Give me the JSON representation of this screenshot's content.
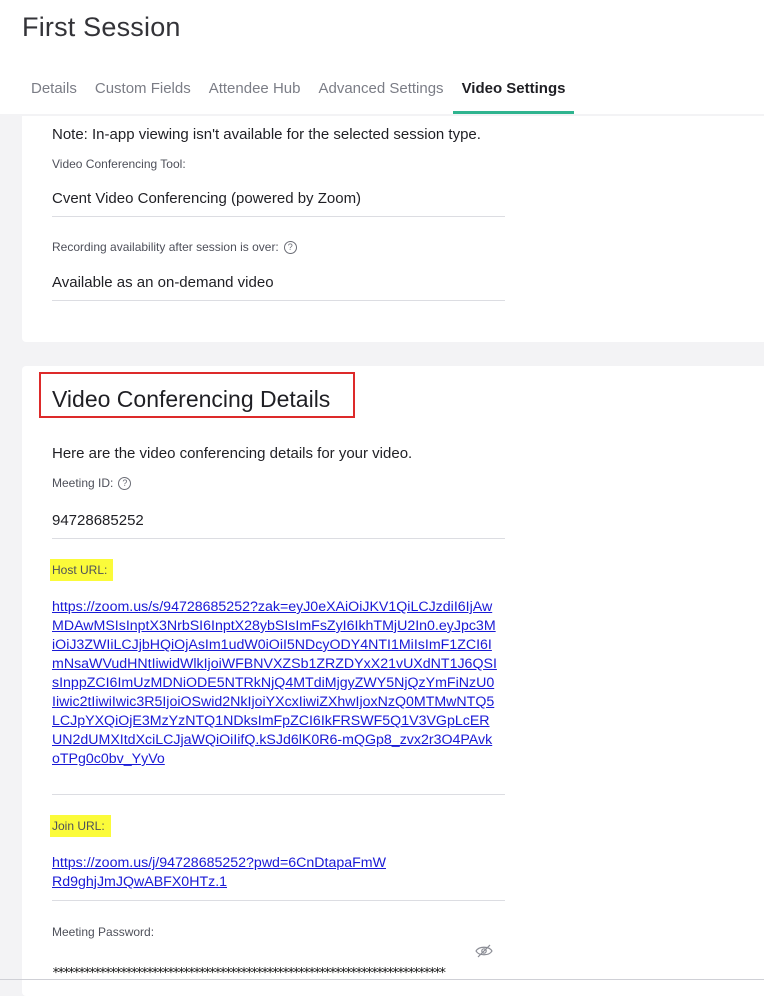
{
  "page": {
    "title": "First Session"
  },
  "tabs": [
    {
      "label": "Details"
    },
    {
      "label": "Custom Fields"
    },
    {
      "label": "Attendee Hub"
    },
    {
      "label": "Advanced Settings"
    },
    {
      "label": "Video Settings",
      "active": true
    }
  ],
  "video_settings": {
    "note": "Note: In-app viewing isn't available for the selected session type.",
    "tool_label": "Video Conferencing Tool:",
    "tool_value": "Cvent Video Conferencing (powered by Zoom)",
    "recording_label": "Recording availability after session is over:",
    "recording_value": "Available as an on-demand video"
  },
  "conferencing": {
    "title": "Video Conferencing Details",
    "intro": "Here are the video conferencing details for your video.",
    "meeting_id_label": "Meeting ID:",
    "meeting_id": "94728685252",
    "host_label": "Host URL:",
    "host_url": "https://zoom.us/s/94728685252?zak=eyJ0eXAiOiJKV1QiLCJzdiI6IjAwMDAwMSIsInptX3NrbSI6InptX28ybSIsImFsZyI6IkhTMjU2In0.eyJpc3MiOiJ3ZWIiLCJjbHQiOjAsIm1udW0iOiI5NDcyODY4NTI1MiIsImF1ZCI6ImNsaWVudHNtIiwidWlkIjoiWFBNVXZSb1ZRZDYxX21vUXdNT1J6QSIsInppZCI6ImUzMDNiODE5NTRkNjQ4MTdiMjgyZWY5NjQzYmFiNzU0Iiwic2tIiwiIwic3R5IjoiOSwid2NkIjoiYXcxIiwiZXhwIjoxNzQ0MTMwNTQ5LCJpYXQiOjE3MzYzNTQ1NDksImFpZCI6IkFRSWF5Q1V3VGpLcERUN2dUMXItdXciLCJjaWQiOiIifQ.kSJd6lK0R6-mQGp8_zvx2r3O4PAvkoTPg0c0bv_YyVo",
    "join_label": "Join URL:",
    "join_url": "https://zoom.us/j/94728685252?pwd=6CnDtapaFmWRd9ghjJmJQwABFX0HTz.1",
    "password_label": "Meeting Password:",
    "password_masked": "***************************************************************************"
  },
  "icons": {
    "help": "help-circle-icon",
    "visibility": "eye-off-icon"
  },
  "colors": {
    "accent": "#2fb48f",
    "highlight": "#fbfb3a",
    "annotation": "#dd2a2a",
    "link": "#1a1ad6"
  }
}
